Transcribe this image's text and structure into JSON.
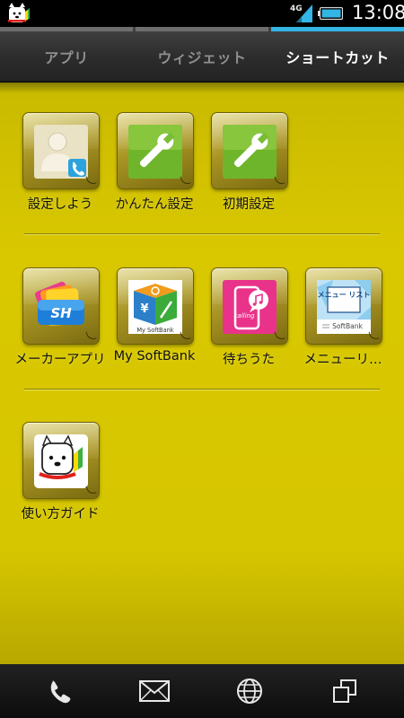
{
  "status_bar": {
    "time": "13:08",
    "network_type": "4G",
    "icons": [
      "softbank-dog-notification-icon",
      "signal-strength-icon",
      "battery-icon"
    ]
  },
  "tabs": [
    {
      "label": "アプリ",
      "active": false
    },
    {
      "label": "ウィジェット",
      "active": false
    },
    {
      "label": "ショートカット",
      "active": true
    }
  ],
  "colors": {
    "drawer_background": "#d6c600",
    "tab_indicator_active": "#33b5e5",
    "tab_indicator_inactive": "#6e6e6e"
  },
  "shortcuts": [
    {
      "label": "設定しよう",
      "icon": "person-phone-icon"
    },
    {
      "label": "かんたん設定",
      "icon": "wrench-icon"
    },
    {
      "label": "初期設定",
      "icon": "wrench-icon"
    },
    {
      "label": "メーカーアプリ",
      "icon": "sh-maker-apps-icon"
    },
    {
      "label": "My SoftBank",
      "icon": "my-softbank-icon",
      "icon_text": "My SoftBank"
    },
    {
      "label": "待ちうた",
      "icon": "calling-music-icon",
      "icon_text": "calling"
    },
    {
      "label": "メニューリ…",
      "icon": "menu-list-icon",
      "icon_text": "メニュー リスト",
      "icon_text2": "SoftBank"
    },
    {
      "label": "使い方ガイド",
      "icon": "guide-dog-icon"
    }
  ],
  "nav_bar": {
    "buttons": [
      "phone-icon",
      "mail-icon",
      "browser-globe-icon",
      "recent-apps-icon"
    ]
  }
}
